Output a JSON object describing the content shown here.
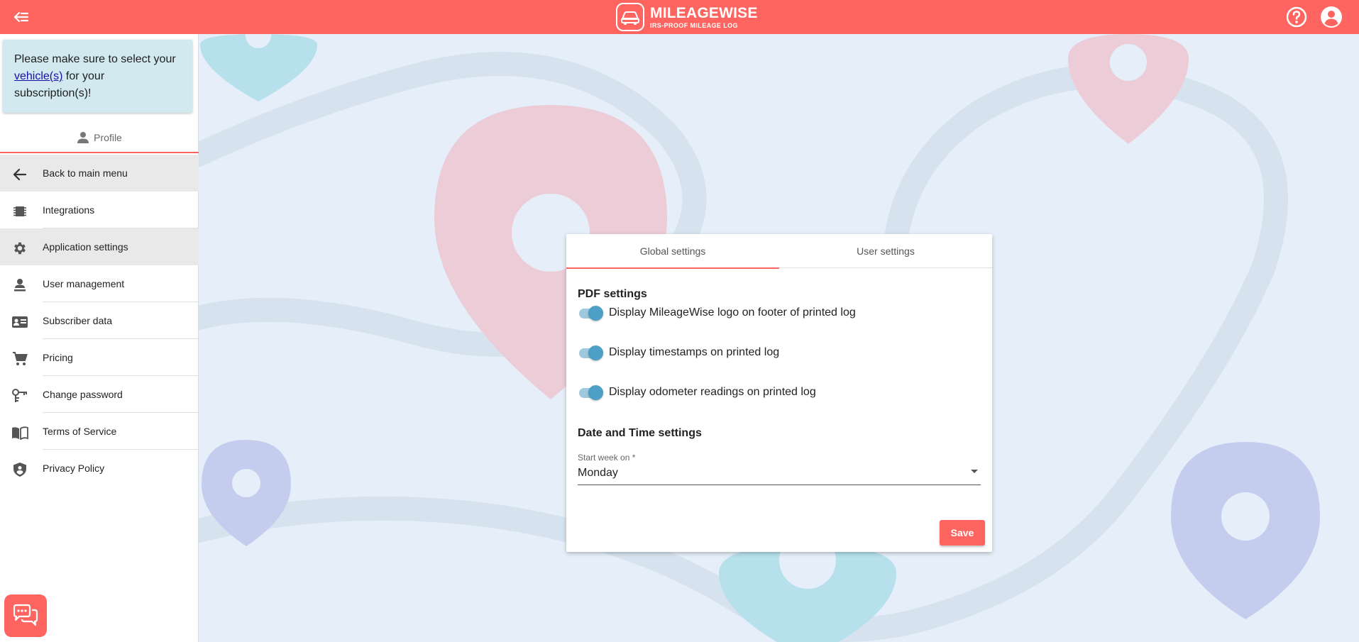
{
  "header": {
    "logo_title": "MILEAGEWISE",
    "logo_subtitle": "IRS-PROOF MILEAGE LOG",
    "back_icon": "menu-back-icon",
    "help_icon": "help-circle-icon",
    "account_icon": "account-circle-icon"
  },
  "sidebar": {
    "notice": {
      "before": "Please make sure to select your ",
      "link": "vehicle(s)",
      "after": " for your subscription(s)!"
    },
    "profile_label": "Profile",
    "items": [
      {
        "label": "Back to main menu",
        "icon": "arrow-left-icon"
      },
      {
        "label": "Integrations",
        "icon": "chip-icon"
      },
      {
        "label": "Application settings",
        "icon": "gear-icon"
      },
      {
        "label": "User management",
        "icon": "user-management-icon"
      },
      {
        "label": "Subscriber data",
        "icon": "id-card-icon"
      },
      {
        "label": "Pricing",
        "icon": "cart-icon"
      },
      {
        "label": "Change password",
        "icon": "key-icon"
      },
      {
        "label": "Terms of Service",
        "icon": "book-icon"
      },
      {
        "label": "Privacy Policy",
        "icon": "shield-icon"
      }
    ]
  },
  "card": {
    "tabs": [
      {
        "label": "Global settings",
        "active": true
      },
      {
        "label": "User settings",
        "active": false
      }
    ],
    "pdf_section_title": "PDF settings",
    "toggles": [
      {
        "label": "Display MileageWise logo on footer of printed log",
        "checked": true
      },
      {
        "label": "Display timestamps on printed log",
        "checked": true
      },
      {
        "label": "Display odometer readings on printed log",
        "checked": true
      }
    ],
    "datetime_section_title": "Date and Time settings",
    "start_week": {
      "label": "Start week on *",
      "value": "Monday"
    },
    "save_label": "Save"
  },
  "colors": {
    "brand": "#fe6560",
    "toggle_on": "#4c9fc6",
    "notice_bg": "#d2e9f0",
    "page_bg": "#e6eff9"
  }
}
